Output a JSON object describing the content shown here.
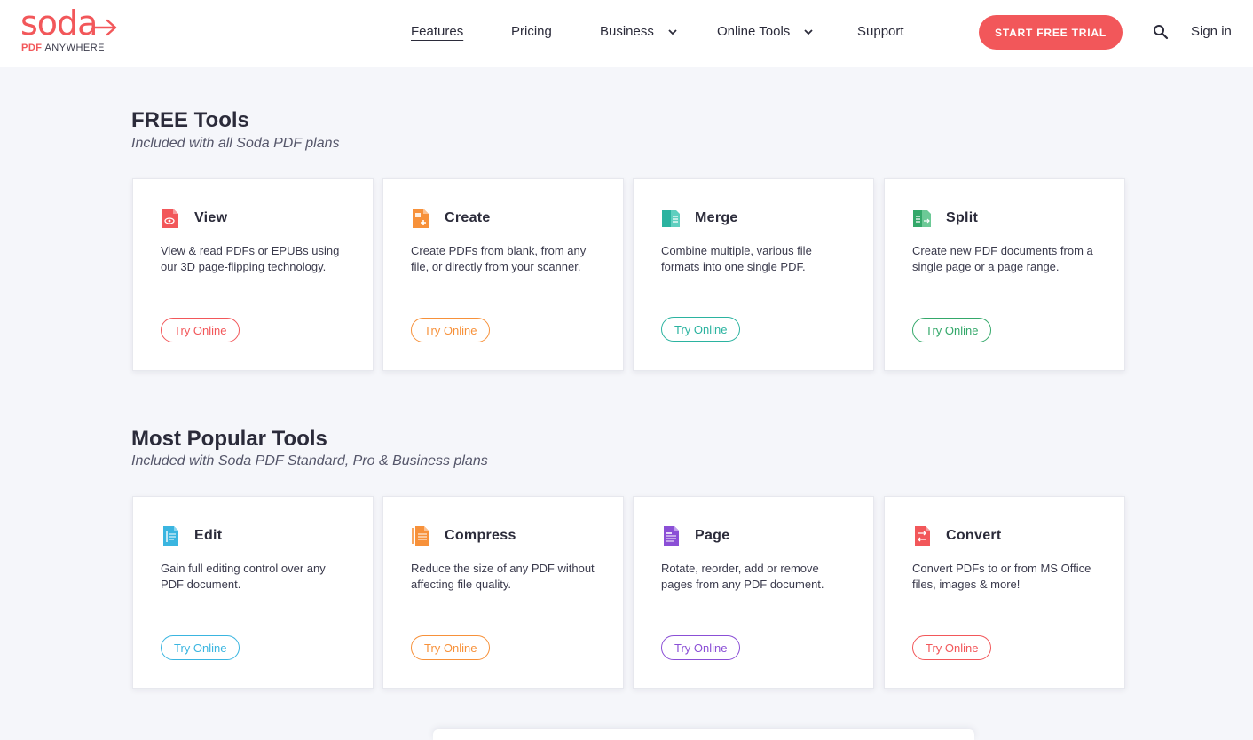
{
  "header": {
    "logo": {
      "word": "soda",
      "sub_brand": "PDF",
      "sub_rest": "ANYWHERE"
    },
    "nav": [
      {
        "label": "Features"
      },
      {
        "label": "Pricing"
      },
      {
        "label": "Business"
      },
      {
        "label": "Online Tools"
      },
      {
        "label": "Support"
      }
    ],
    "trial_label": "START FREE TRIAL",
    "signin_label": "Sign in"
  },
  "free_section": {
    "title": "FREE Tools",
    "subtitle": "Included with all Soda PDF plans",
    "cards": [
      {
        "title": "View",
        "desc": "View & read PDFs or EPUBs using our 3D page-flipping technology.",
        "button": "Try Online",
        "color": "#f2575a",
        "icon": "view-doc-icon"
      },
      {
        "title": "Create",
        "desc": "Create PDFs from blank, from any file, or directly from your scanner.",
        "button": "Try Online",
        "color": "#f7913a",
        "icon": "create-doc-icon"
      },
      {
        "title": "Merge",
        "desc": "Combine multiple, various file formats into one single PDF.",
        "button": "Try Online",
        "color": "#2bb3a0",
        "icon": "merge-doc-icon"
      },
      {
        "title": "Split",
        "desc": "Create new PDF documents from a single page or a page range.",
        "button": "Try Online",
        "color": "#34a86a",
        "icon": "split-doc-icon"
      }
    ]
  },
  "popular_section": {
    "title": "Most Popular Tools",
    "subtitle": "Included with Soda PDF Standard, Pro & Business plans",
    "cards": [
      {
        "title": "Edit",
        "desc": "Gain full editing control over any PDF document.",
        "button": "Try Online",
        "color": "#3ab5e0",
        "icon": "edit-doc-icon"
      },
      {
        "title": "Compress",
        "desc": "Reduce the size of any PDF without affecting file quality.",
        "button": "Try Online",
        "color": "#f7913a",
        "icon": "compress-doc-icon"
      },
      {
        "title": "Page",
        "desc": "Rotate, reorder, add or remove pages from any PDF document.",
        "button": "Try Online",
        "color": "#8b4fd6",
        "icon": "page-doc-icon"
      },
      {
        "title": "Convert",
        "desc": "Convert PDFs to or from MS Office files, images & more!",
        "button": "Try Online",
        "color": "#f2575a",
        "icon": "convert-doc-icon"
      }
    ]
  }
}
